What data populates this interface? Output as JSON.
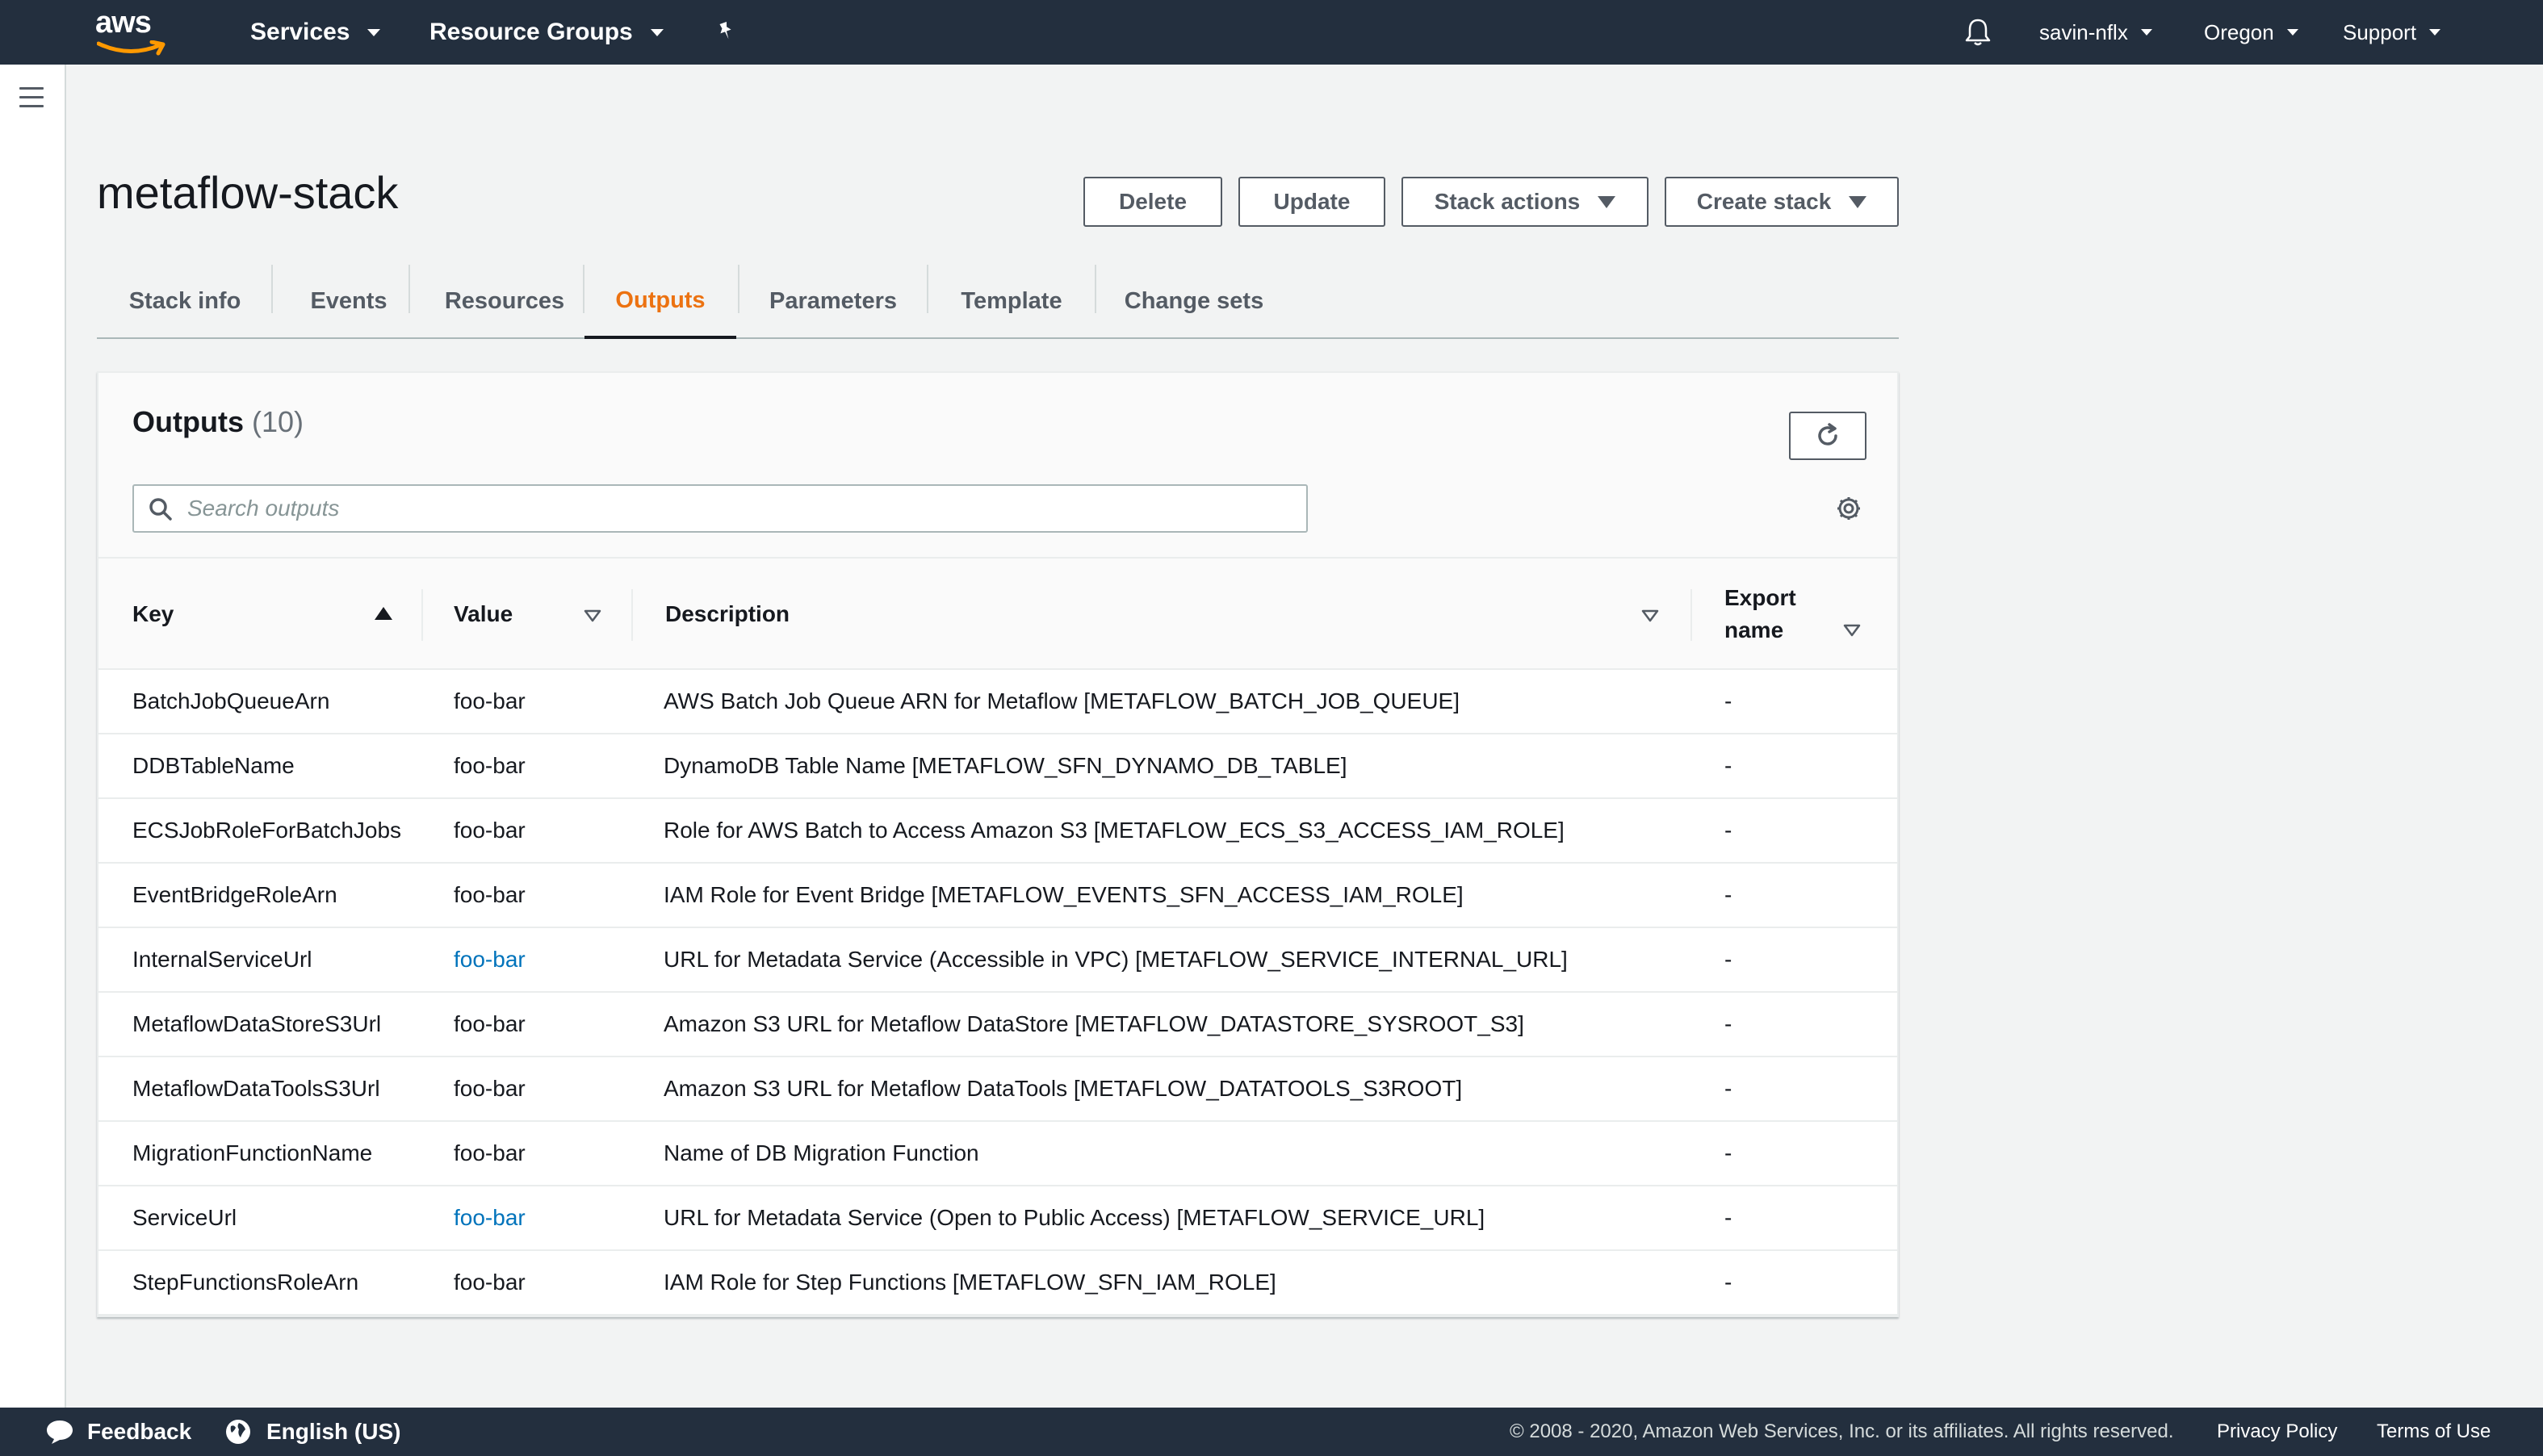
{
  "topnav": {
    "logo_text": "aws",
    "services": "Services",
    "resource_groups": "Resource Groups",
    "user": "savin-nflx",
    "region": "Oregon",
    "support": "Support"
  },
  "header": {
    "title": "metaflow-stack",
    "buttons": {
      "delete": "Delete",
      "update": "Update",
      "stack_actions": "Stack actions",
      "create_stack": "Create stack"
    }
  },
  "tabs": [
    {
      "label": "Stack info"
    },
    {
      "label": "Events"
    },
    {
      "label": "Resources"
    },
    {
      "label": "Outputs",
      "active": true
    },
    {
      "label": "Parameters"
    },
    {
      "label": "Template"
    },
    {
      "label": "Change sets"
    }
  ],
  "outputs": {
    "title": "Outputs",
    "count": "(10)",
    "search_placeholder": "Search outputs",
    "columns": {
      "key": "Key",
      "value": "Value",
      "description": "Description",
      "export_line1": "Export",
      "export_line2": "name"
    },
    "rows": [
      {
        "key": "BatchJobQueueArn",
        "value": "foo-bar",
        "description": "AWS Batch Job Queue ARN for Metaflow [METAFLOW_BATCH_JOB_QUEUE]",
        "export": "-",
        "is_link": false
      },
      {
        "key": "DDBTableName",
        "value": "foo-bar",
        "description": "DynamoDB Table Name [METAFLOW_SFN_DYNAMO_DB_TABLE]",
        "export": "-",
        "is_link": false
      },
      {
        "key": "ECSJobRoleForBatchJobs",
        "value": "foo-bar",
        "description": "Role for AWS Batch to Access Amazon S3 [METAFLOW_ECS_S3_ACCESS_IAM_ROLE]",
        "export": "-",
        "is_link": false
      },
      {
        "key": "EventBridgeRoleArn",
        "value": "foo-bar",
        "description": "IAM Role for Event Bridge [METAFLOW_EVENTS_SFN_ACCESS_IAM_ROLE]",
        "export": "-",
        "is_link": false
      },
      {
        "key": "InternalServiceUrl",
        "value": "foo-bar",
        "description": "URL for Metadata Service (Accessible in VPC) [METAFLOW_SERVICE_INTERNAL_URL]",
        "export": "-",
        "is_link": true
      },
      {
        "key": "MetaflowDataStoreS3Url",
        "value": "foo-bar",
        "description": "Amazon S3 URL for Metaflow DataStore [METAFLOW_DATASTORE_SYSROOT_S3]",
        "export": "-",
        "is_link": false
      },
      {
        "key": "MetaflowDataToolsS3Url",
        "value": "foo-bar",
        "description": "Amazon S3 URL for Metaflow DataTools [METAFLOW_DATATOOLS_S3ROOT]",
        "export": "-",
        "is_link": false
      },
      {
        "key": "MigrationFunctionName",
        "value": "foo-bar",
        "description": "Name of DB Migration Function",
        "export": "-",
        "is_link": false
      },
      {
        "key": "ServiceUrl",
        "value": "foo-bar",
        "description": "URL for Metadata Service (Open to Public Access) [METAFLOW_SERVICE_URL]",
        "export": "-",
        "is_link": true
      },
      {
        "key": "StepFunctionsRoleArn",
        "value": "foo-bar",
        "description": "IAM Role for Step Functions [METAFLOW_SFN_IAM_ROLE]",
        "export": "-",
        "is_link": false
      }
    ]
  },
  "footer": {
    "feedback": "Feedback",
    "language": "English (US)",
    "copyright": "© 2008 - 2020, Amazon Web Services, Inc. or its affiliates. All rights reserved.",
    "privacy": "Privacy Policy",
    "terms": "Terms of Use"
  },
  "colors": {
    "nav_bg": "#232f3e",
    "accent_orange": "#ec7211",
    "link_blue": "#0073bb",
    "logo_smile": "#ff9900"
  },
  "icons": [
    "bell-icon",
    "pin-icon",
    "hamburger-icon",
    "refresh-icon",
    "search-icon",
    "gear-icon",
    "speech-bubble-icon",
    "globe-icon"
  ]
}
